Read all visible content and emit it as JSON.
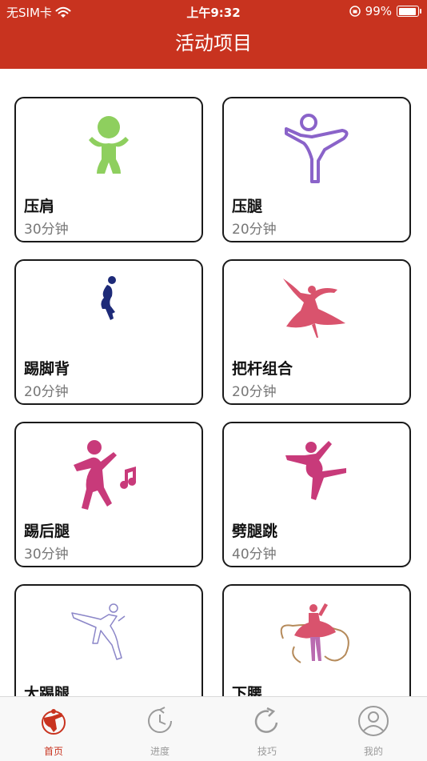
{
  "status_bar": {
    "carrier": "无SIM卡",
    "time": "上午9:32",
    "battery": "99%"
  },
  "header": {
    "title": "活动项目"
  },
  "activities": [
    {
      "name": "压肩",
      "duration": "30分钟",
      "icon": "stretch-figure-icon",
      "color": "#8ecf5e"
    },
    {
      "name": "压腿",
      "duration": "20分钟",
      "icon": "leg-press-figure-icon",
      "color": "#8a63c9"
    },
    {
      "name": "踢脚背",
      "duration": "20分钟",
      "icon": "kick-figure-icon",
      "color": "#1d2a78"
    },
    {
      "name": "把杆组合",
      "duration": "20分钟",
      "icon": "dancer-figure-icon",
      "color": "#d9536d"
    },
    {
      "name": "踢后腿",
      "duration": "30分钟",
      "icon": "music-dance-figure-icon",
      "color": "#c83a7a"
    },
    {
      "name": "劈腿跳",
      "duration": "40分钟",
      "icon": "leap-figure-icon",
      "color": "#c83a7a"
    },
    {
      "name": "大踢腿",
      "duration": "",
      "icon": "high-kick-figure-icon",
      "color": "#8b86c8"
    },
    {
      "name": "下腰",
      "duration": "",
      "icon": "ballerina-ribbon-icon",
      "color": "#d9536d"
    }
  ],
  "tabs": [
    {
      "label": "首页",
      "icon": "home-dancer-icon",
      "active": true
    },
    {
      "label": "进度",
      "icon": "progress-clock-icon",
      "active": false
    },
    {
      "label": "技巧",
      "icon": "tips-refresh-icon",
      "active": false
    },
    {
      "label": "我的",
      "icon": "profile-icon",
      "active": false
    }
  ],
  "colors": {
    "header": "#c8331f",
    "active_tab": "#c8331f",
    "inactive_tab": "#9a9a9a"
  }
}
